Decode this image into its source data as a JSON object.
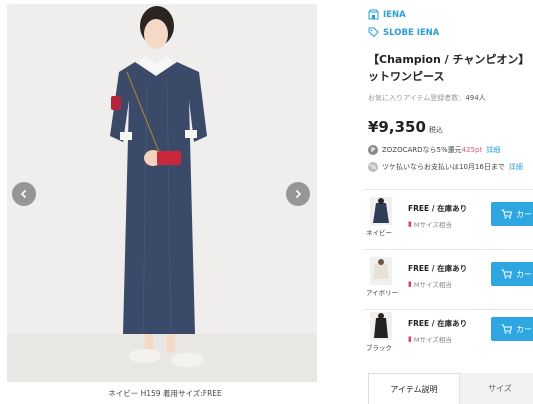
{
  "gallery": {
    "caption": "ネイビー H159 着用サイズ:FREE",
    "prev_icon": "chevron-left-icon",
    "next_icon": "chevron-right-icon"
  },
  "brands": [
    {
      "label": "IENA",
      "icon": "shop-icon"
    },
    {
      "label": "SLOBE IENA",
      "icon": "tag-icon"
    }
  ],
  "product": {
    "title_line1": "【Champion / チャンピオン】",
    "title_line2": "ットワンピース",
    "fav_label": "お気に入りアイテム登録者数：",
    "fav_count": "494人",
    "price": "¥9,350",
    "tax_label": "税込"
  },
  "promos": {
    "zozocard_prefix": "ZOZOCARDなら5%還元",
    "zozocard_points": "425pt",
    "zozocard_link": "詳細",
    "tsuke_text": "ツケ払いならお支払いは10月16日まで",
    "tsuke_link": "詳細",
    "p_badge": "P"
  },
  "variants": [
    {
      "color": "ネイビー",
      "size": "FREE / 在庫あり",
      "note": "Mサイズ相当",
      "cart_label": "カー",
      "swatch": "#2f3d57"
    },
    {
      "color": "アイボリー",
      "size": "FREE / 在庫あり",
      "note": "Mサイズ相当",
      "cart_label": "カー",
      "swatch": "#e8e2d6"
    },
    {
      "color": "ブラック",
      "size": "FREE / 在庫あり",
      "note": "Mサイズ相当",
      "cart_label": "カー",
      "swatch": "#222222"
    }
  ],
  "tabs": [
    {
      "label": "アイテム説明"
    },
    {
      "label": "サイズ"
    }
  ],
  "colors": {
    "accent": "#2ea7e0",
    "link": "#2a9fd8",
    "highlight": "#e35e7a"
  }
}
